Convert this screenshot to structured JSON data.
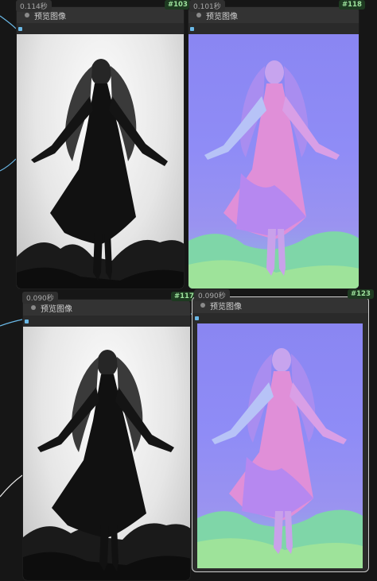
{
  "nodes": [
    {
      "id": "#103",
      "time": "0.114秒",
      "title": "预览图像"
    },
    {
      "id": "#118",
      "time": "0.101秒",
      "title": "预览图像"
    },
    {
      "id": "#117",
      "time": "0.090秒",
      "title": "预览图像"
    },
    {
      "id": "#123",
      "time": "0.090秒",
      "title": "预览图像"
    }
  ],
  "colors": {
    "canvas": "#161616",
    "node_body": "#2a2a2a",
    "node_header": "#333333",
    "link": "#6ab8e6",
    "id_badge": "#9de29d"
  }
}
